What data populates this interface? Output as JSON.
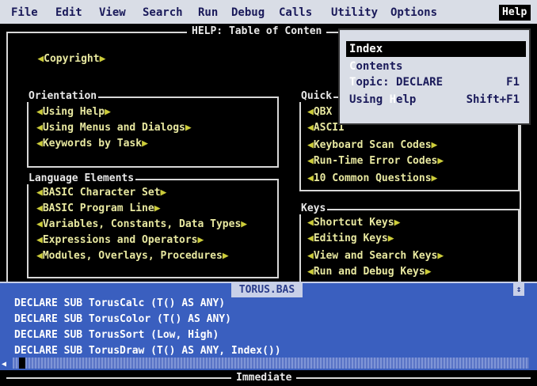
{
  "menubar": {
    "items": [
      "File",
      "Edit",
      "View",
      "Search",
      "Run",
      "Debug",
      "Calls",
      "Utility",
      "Options"
    ],
    "help": "Help"
  },
  "help_window": {
    "title": "HELP: Table of Conten",
    "copyright": "Copyright",
    "sections": {
      "orientation": {
        "title": "Orientation",
        "links": [
          "Using Help",
          "Using Menus and Dialogs",
          "Keywords by Task"
        ]
      },
      "language": {
        "title": "Language Elements",
        "links": [
          "BASIC Character Set",
          "BASIC Program Line",
          "Variables, Constants, Data Types",
          "Expressions and Operators",
          "Modules, Overlays, Procedures"
        ]
      },
      "quick": {
        "title": "Quick",
        "links": [
          "QBX",
          "ASCII",
          "Keyboard Scan Codes",
          "Run-Time Error Codes",
          "10 Common Questions"
        ]
      },
      "keys": {
        "title": "Keys",
        "links": [
          "Shortcut Keys",
          "Editing Keys",
          "View and Search Keys",
          "Run and Debug Keys"
        ]
      }
    }
  },
  "help_menu": {
    "items": [
      {
        "hot": "I",
        "rest": "ndex",
        "shortcut": ""
      },
      {
        "hot": "C",
        "rest": "ontents",
        "shortcut": ""
      },
      {
        "hot": "T",
        "rest": "opic: DECLARE",
        "shortcut": "F1"
      },
      {
        "pre": "Using ",
        "hot": "H",
        "rest": "elp",
        "shortcut": "Shift+F1"
      }
    ]
  },
  "source_window": {
    "title": "TORUS.BAS",
    "lines": [
      "DECLARE SUB TorusCalc (T() AS ANY)",
      "DECLARE SUB TorusColor (T() AS ANY)",
      "DECLARE SUB TorusSort (Low, High)",
      "DECLARE SUB TorusDraw (T() AS ANY, Index())"
    ]
  },
  "immediate": {
    "title": "Immediate"
  },
  "colors": {
    "menubar": "#d9dde6",
    "help_bg": "#000000",
    "source_bg": "#3a5fbf",
    "link": "#e8e8a0"
  }
}
